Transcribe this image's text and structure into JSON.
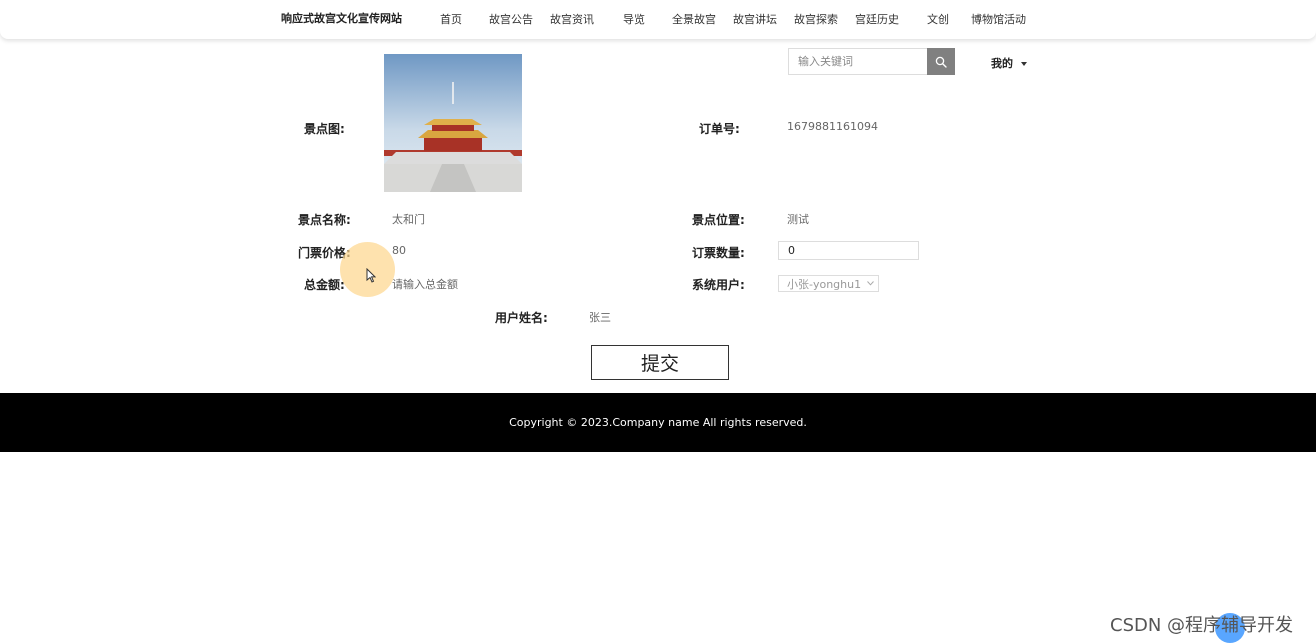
{
  "header": {
    "brand": "响应式故宫文化宣传网站",
    "nav": [
      "首页",
      "故宫公告",
      "故宫资讯",
      "导览",
      "全景故宫",
      "故宫讲坛",
      "故宫探索",
      "宫廷历史",
      "文创",
      "博物馆活动"
    ]
  },
  "search": {
    "placeholder": "输入关键词",
    "icon": "search-icon"
  },
  "user_menu": {
    "label": "我的"
  },
  "form": {
    "image_label": "景点图:",
    "order_no_label": "订单号:",
    "order_no": "1679881161094",
    "name_label": "景点名称:",
    "name": "太和门",
    "location_label": "景点位置:",
    "location": "测试",
    "price_label": "门票价格:",
    "price": "80",
    "qty_label": "订票数量:",
    "qty": "0",
    "total_label": "总金额:",
    "total_placeholder": "请输入总金额",
    "sys_user_label": "系统用户:",
    "sys_user": "小张-yonghu1",
    "username_label": "用户姓名:",
    "username": "张三",
    "submit": "提交"
  },
  "footer": {
    "copyright": "Copyright © 2023.Company name All rights reserved."
  },
  "watermark": "CSDN @程序辅导开发"
}
